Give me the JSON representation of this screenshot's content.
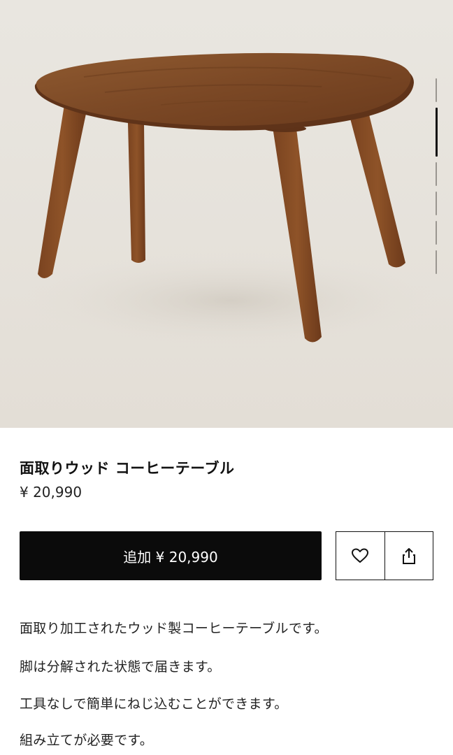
{
  "product": {
    "image_alt": "wood-coffee-table-photo",
    "title": "面取りウッド コーヒーテーブル",
    "price": "¥ 20,990"
  },
  "gallery": {
    "total_images": 7,
    "active_index": 1
  },
  "actions": {
    "add_button_label": "追加 ¥ 20,990",
    "favorite_icon": "heart-icon",
    "share_icon": "share-icon"
  },
  "description": {
    "lines": [
      "面取り加工されたウッド製コーヒーテーブルです。",
      "脚は分解された状態で届きます。",
      "工具なしで簡単にねじ込むことができます。",
      "組み立てが必要です。"
    ]
  }
}
